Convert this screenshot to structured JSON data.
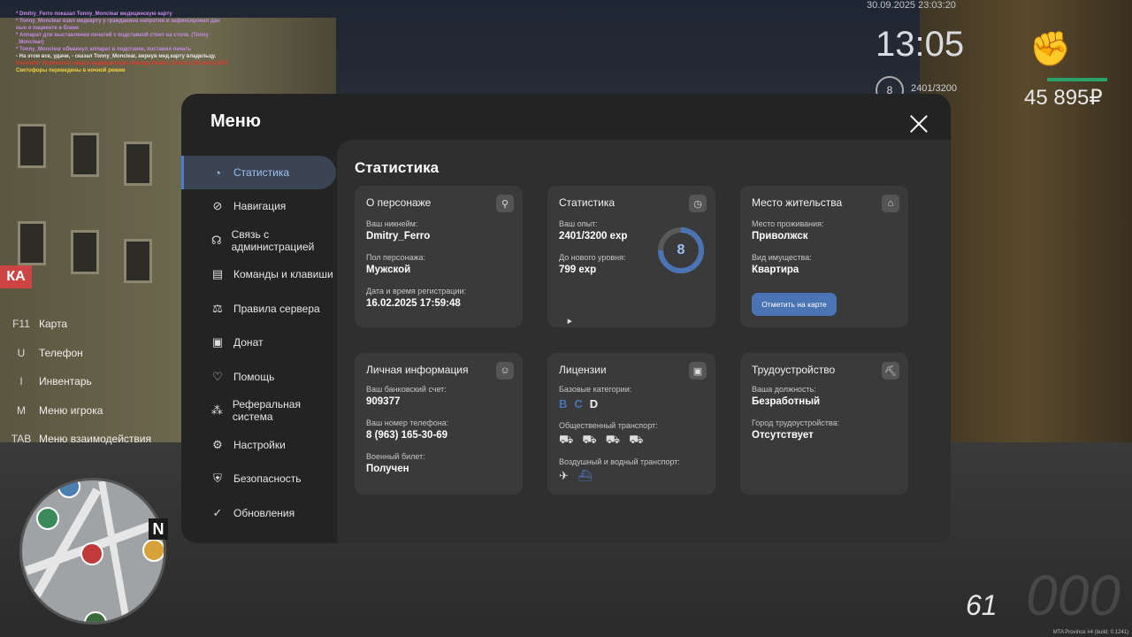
{
  "chat": [
    {
      "text": "* Dmitry_Ferro показал Tonny_Monclear медицинскую карту",
      "color": "#c58be6"
    },
    {
      "text": "* Tonny_Monclear взял медкарту у гражданина напротив и зафиксировал дан",
      "color": "#c58be6"
    },
    {
      "text": "ные о пациенте в бланк",
      "color": "#c58be6"
    },
    {
      "text": "* Аппарат для выставления печатей с подставкой стоит на столе. (Tonny",
      "color": "#c58be6"
    },
    {
      "text": "_Monclear)",
      "color": "#c58be6"
    },
    {
      "text": "* Tonny_Monclear обмакнул аппарат в подставке, поставил печать",
      "color": "#c58be6"
    },
    {
      "text": "- На этом все, удачи, - сказал Tonny_Monclear, вернув мед.карту владельцу.",
      "color": "#e8e8e8"
    },
    {
      "text": "Vsevolod_Rozmovich оказал медицинскую помощь Robert_Dobrov (30 мин) [1801ly96]",
      "color": "#e0392b"
    },
    {
      "text": "Светофоры переведены в ночной режим",
      "color": "#f2d33a"
    }
  ],
  "hud": {
    "datetime": "30.09.2025 23:03:20",
    "time": "13:05",
    "level": "8",
    "exp": "2401/3200",
    "money": "45 895₽",
    "speed": "61",
    "build": "MTA Province #4 (build: 0.1241)"
  },
  "keybinds": [
    {
      "key": "F11",
      "label": "Карта"
    },
    {
      "key": "U",
      "label": "Телефон"
    },
    {
      "key": "I",
      "label": "Инвентарь"
    },
    {
      "key": "M",
      "label": "Меню игрока"
    },
    {
      "key": "TAB",
      "label": "Меню взаимодействия"
    }
  ],
  "minimap": {
    "north": "N"
  },
  "menu": {
    "title": "Меню",
    "nav": [
      {
        "label": "Статистика",
        "icon": "pie-chart-icon",
        "glyph": "◔",
        "active": true
      },
      {
        "label": "Навигация",
        "icon": "compass-icon",
        "glyph": "⊘"
      },
      {
        "label": "Связь с администрацией",
        "icon": "headset-icon",
        "glyph": "☊"
      },
      {
        "label": "Команды и клавиши",
        "icon": "document-icon",
        "glyph": "▤"
      },
      {
        "label": "Правила сервера",
        "icon": "scales-icon",
        "glyph": "⚖"
      },
      {
        "label": "Донат",
        "icon": "wallet-icon",
        "glyph": "▣"
      },
      {
        "label": "Помощь",
        "icon": "handshake-icon",
        "glyph": "♡"
      },
      {
        "label": "Реферальная система",
        "icon": "network-icon",
        "glyph": "⁂"
      },
      {
        "label": "Настройки",
        "icon": "gear-icon",
        "glyph": "⚙"
      },
      {
        "label": "Безопасность",
        "icon": "shield-icon",
        "glyph": "⛨"
      },
      {
        "label": "Обновления",
        "icon": "refresh-check-icon",
        "glyph": "✓"
      }
    ],
    "section_title": "Статистика",
    "cards": {
      "character": {
        "title": "О персонаже",
        "icon": "user-icon",
        "nickname_label": "Ваш никнейм:",
        "nickname": "Dmitry_Ferro",
        "gender_label": "Пол персонажа:",
        "gender": "Мужской",
        "reg_label": "Дата и время регистрации:",
        "reg": "16.02.2025 17:59:48"
      },
      "stats": {
        "title": "Статистика",
        "icon": "clock-chart-icon",
        "exp_label": "Ваш опыт:",
        "exp": "2401/3200 exp",
        "next_label": "До нового уровня:",
        "next": "799 exp",
        "level": "8",
        "progress": 0.75
      },
      "residence": {
        "title": "Место жительства",
        "icon": "home-icon",
        "place_label": "Место проживания:",
        "place": "Приволжск",
        "property_label": "Вид имущества:",
        "property": "Квартира",
        "button": "Отметить на карте"
      },
      "personal": {
        "title": "Личная информация",
        "icon": "user-circle-icon",
        "bank_label": "Ваш банковский счет:",
        "bank": "909377",
        "phone_label": "Ваш номер телефона:",
        "phone": "8 (963) 165-30-69",
        "military_label": "Военный билет:",
        "military": "Получен"
      },
      "licenses": {
        "title": "Лицензии",
        "icon": "id-card-icon",
        "base_label": "Базовые категории:",
        "categories": [
          {
            "letter": "B",
            "owned": true
          },
          {
            "letter": "C",
            "owned": true
          },
          {
            "letter": "D",
            "owned": false
          }
        ],
        "public_label": "Общественный транспорт:",
        "public_icons": [
          "bus-icon",
          "trolleybus-icon",
          "tram-icon",
          "minibus-icon"
        ],
        "air_label": "Воздушный и водный транспорт:",
        "air_icons": [
          "plane-icon",
          "ship-icon"
        ]
      },
      "job": {
        "title": "Трудоустройство",
        "icon": "pickaxe-icon",
        "position_label": "Ваша должность:",
        "position": "Безработный",
        "city_label": "Город трудоустройства:",
        "city": "Отсутствует"
      }
    }
  }
}
